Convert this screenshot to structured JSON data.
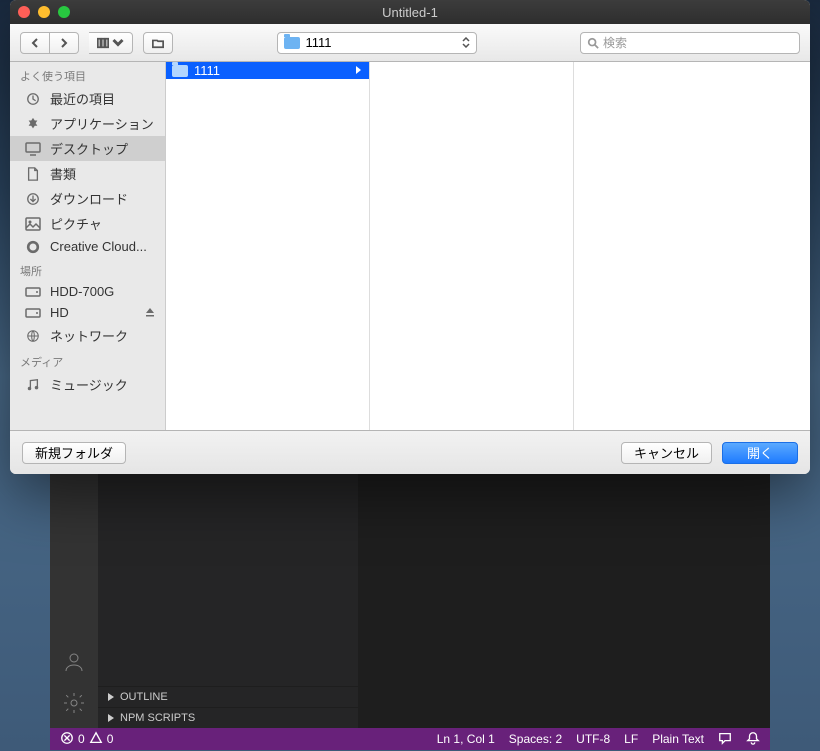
{
  "titlebar": {
    "title": "Untitled-1"
  },
  "toolbar": {
    "path_folder": "1111",
    "search_placeholder": "検索"
  },
  "sidebar": {
    "sections": [
      {
        "header": "よく使う項目",
        "items": [
          {
            "icon": "clock",
            "label": "最近の項目"
          },
          {
            "icon": "apps",
            "label": "アプリケーション"
          },
          {
            "icon": "desktop",
            "label": "デスクトップ",
            "selected": true
          },
          {
            "icon": "doc",
            "label": "書類"
          },
          {
            "icon": "download",
            "label": "ダウンロード"
          },
          {
            "icon": "picture",
            "label": "ピクチャ"
          },
          {
            "icon": "cc",
            "label": "Creative Cloud..."
          }
        ]
      },
      {
        "header": "場所",
        "items": [
          {
            "icon": "hdd",
            "label": "HDD-700G"
          },
          {
            "icon": "hdd",
            "label": "HD",
            "eject": true
          },
          {
            "icon": "globe",
            "label": "ネットワーク"
          }
        ]
      },
      {
        "header": "メディア",
        "items": [
          {
            "icon": "music",
            "label": "ミュージック"
          }
        ]
      }
    ]
  },
  "columns": [
    {
      "items": [
        {
          "label": "1111",
          "selected": true,
          "hasChildren": true
        }
      ]
    },
    {
      "items": []
    },
    {
      "items": []
    }
  ],
  "footer": {
    "new_folder": "新規フォルダ",
    "cancel": "キャンセル",
    "open": "開く"
  },
  "editor": {
    "outline": "OUTLINE",
    "npm": "NPM SCRIPTS"
  },
  "statusbar": {
    "errors": "0",
    "warnings": "0",
    "ln_col": "Ln 1, Col 1",
    "spaces": "Spaces: 2",
    "encoding": "UTF-8",
    "eol": "LF",
    "lang": "Plain Text"
  }
}
